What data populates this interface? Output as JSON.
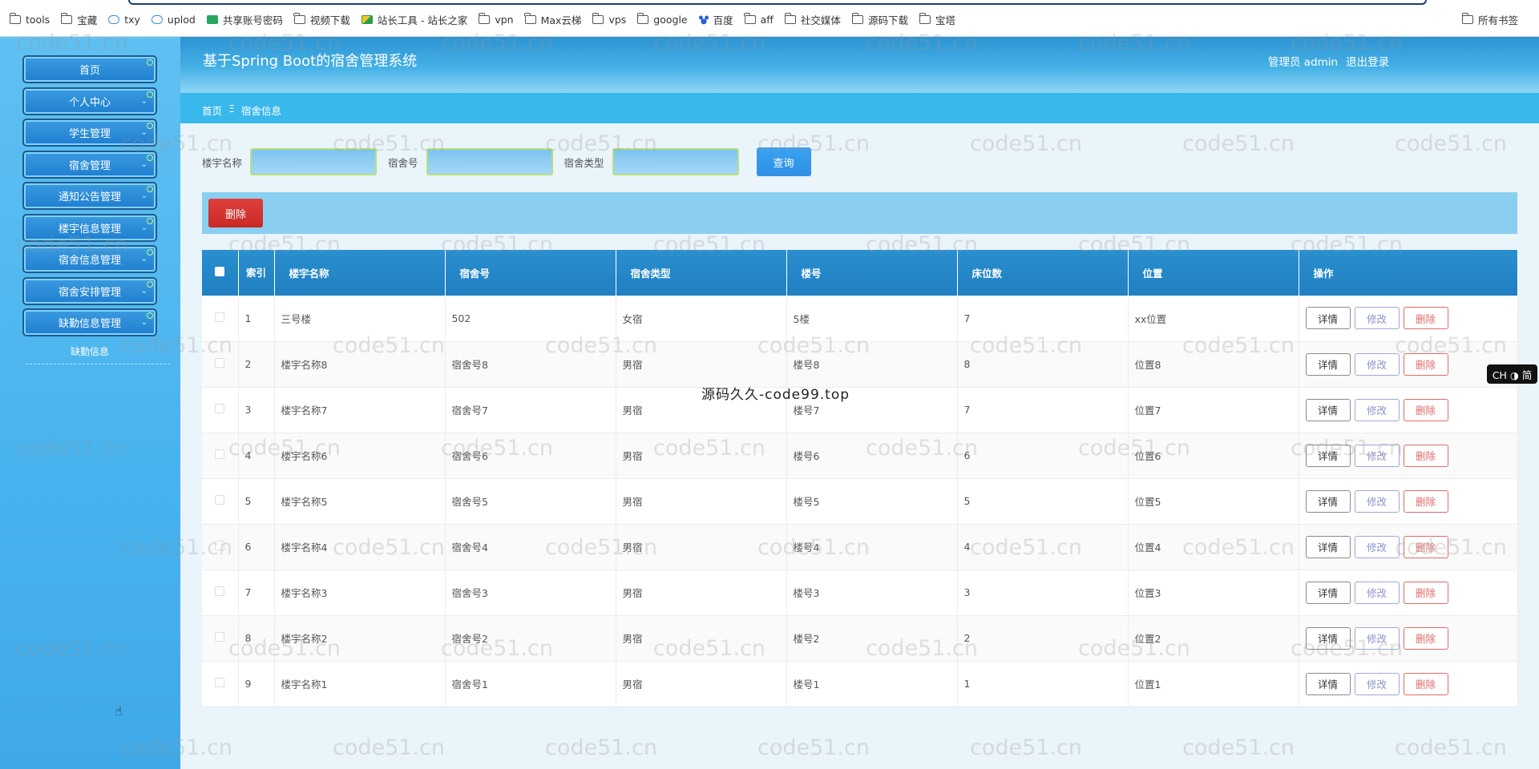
{
  "bookmarks": {
    "items": [
      {
        "label": "tools",
        "icon": "folder-icon"
      },
      {
        "label": "宝藏",
        "icon": "folder-icon"
      },
      {
        "label": "txy",
        "icon": "cloud-icon"
      },
      {
        "label": "uplod",
        "icon": "cloud-icon"
      },
      {
        "label": "共享账号密码",
        "icon": "sheet-icon"
      },
      {
        "label": "视频下载",
        "icon": "folder-icon"
      },
      {
        "label": "站长工具 - 站长之家",
        "icon": "tool-icon"
      },
      {
        "label": "vpn",
        "icon": "folder-icon"
      },
      {
        "label": "Max云梯",
        "icon": "folder-icon"
      },
      {
        "label": "vps",
        "icon": "folder-icon"
      },
      {
        "label": "google",
        "icon": "folder-icon"
      },
      {
        "label": "百度",
        "icon": "paw-icon"
      },
      {
        "label": "aff",
        "icon": "folder-icon"
      },
      {
        "label": "社交媒体",
        "icon": "folder-icon"
      },
      {
        "label": "源码下载",
        "icon": "folder-icon"
      },
      {
        "label": "宝塔",
        "icon": "folder-icon"
      }
    ],
    "all_bookmarks": "所有书签"
  },
  "sidebar": {
    "items": [
      {
        "label": "首页"
      },
      {
        "label": "个人中心"
      },
      {
        "label": "学生管理"
      },
      {
        "label": "宿舍管理"
      },
      {
        "label": "通知公告管理"
      },
      {
        "label": "楼宇信息管理"
      },
      {
        "label": "宿舍信息管理"
      },
      {
        "label": "宿舍安排管理"
      },
      {
        "label": "缺勤信息管理"
      }
    ],
    "sub_item": "缺勤信息"
  },
  "header": {
    "title": "基于Spring Boot的宿舍管理系统",
    "user": "管理员 admin",
    "logout": "退出登录"
  },
  "breadcrumb": {
    "home": "首页",
    "separator": "Ξ",
    "current": "宿舍信息"
  },
  "search": {
    "building_label": "楼宇名称",
    "building_placeholder": "楼宇名称",
    "room_label": "宿舍号",
    "room_placeholder": "宿舍号",
    "type_label": "宿舍类型",
    "type_placeholder": "宿舍类型",
    "query_button": "查询"
  },
  "toolbar": {
    "delete_button": "删除"
  },
  "table": {
    "headers": {
      "index": "索引",
      "building": "楼宇名称",
      "room": "宿舍号",
      "type": "宿舍类型",
      "floor": "楼号",
      "beds": "床位数",
      "location": "位置",
      "actions": "操作"
    },
    "action_labels": {
      "detail": "详情",
      "edit": "修改",
      "remove": "删除"
    },
    "rows": [
      {
        "index": "1",
        "building": "三号楼",
        "room": "502",
        "type": "女宿",
        "floor": "5楼",
        "beds": "7",
        "location": "xx位置"
      },
      {
        "index": "2",
        "building": "楼宇名称8",
        "room": "宿舍号8",
        "type": "男宿",
        "floor": "楼号8",
        "beds": "8",
        "location": "位置8"
      },
      {
        "index": "3",
        "building": "楼宇名称7",
        "room": "宿舍号7",
        "type": "男宿",
        "floor": "楼号7",
        "beds": "7",
        "location": "位置7"
      },
      {
        "index": "4",
        "building": "楼宇名称6",
        "room": "宿舍号6",
        "type": "男宿",
        "floor": "楼号6",
        "beds": "6",
        "location": "位置6"
      },
      {
        "index": "5",
        "building": "楼宇名称5",
        "room": "宿舍号5",
        "type": "男宿",
        "floor": "楼号5",
        "beds": "5",
        "location": "位置5"
      },
      {
        "index": "6",
        "building": "楼宇名称4",
        "room": "宿舍号4",
        "type": "男宿",
        "floor": "楼号4",
        "beds": "4",
        "location": "位置4"
      },
      {
        "index": "7",
        "building": "楼宇名称3",
        "room": "宿舍号3",
        "type": "男宿",
        "floor": "楼号3",
        "beds": "3",
        "location": "位置3"
      },
      {
        "index": "8",
        "building": "楼宇名称2",
        "room": "宿舍号2",
        "type": "男宿",
        "floor": "楼号2",
        "beds": "2",
        "location": "位置2"
      },
      {
        "index": "9",
        "building": "楼宇名称1",
        "room": "宿舍号1",
        "type": "男宿",
        "floor": "楼号1",
        "beds": "1",
        "location": "位置1"
      }
    ]
  },
  "overlay": {
    "center_text": "源码久久-code99.top",
    "watermark": "code51.cn",
    "ime_badge": "CH ◑ 简"
  }
}
